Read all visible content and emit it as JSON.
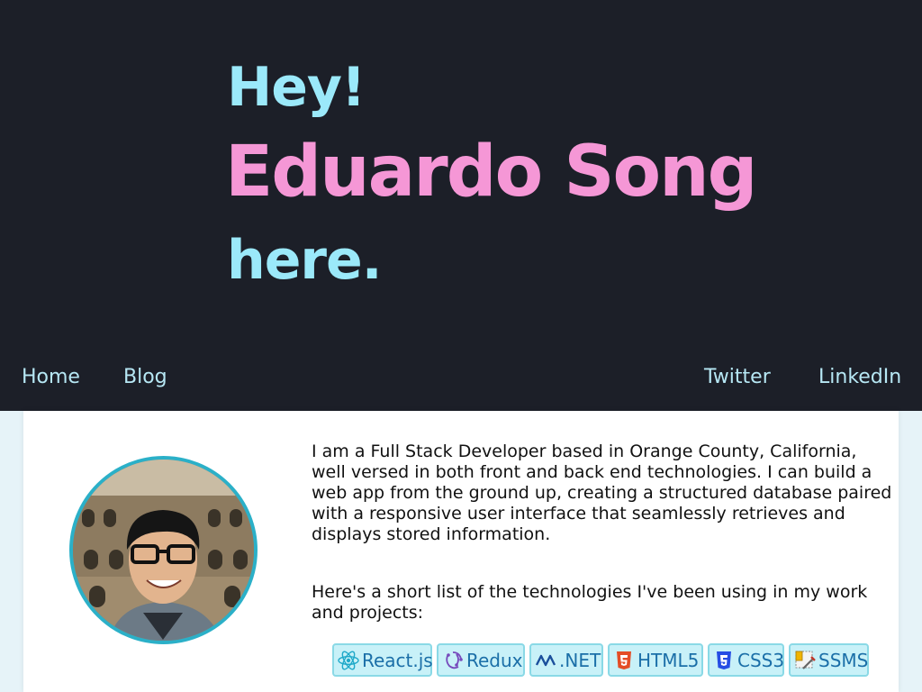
{
  "hero": {
    "greeting": "Hey!",
    "name": "Eduardo Song",
    "tail": "here."
  },
  "nav": {
    "home": "Home",
    "blog": "Blog",
    "twitter": "Twitter",
    "linkedin": "LinkedIn"
  },
  "about": {
    "bio": "I am a Full Stack Developer based in Orange County, California, well versed in both front and back end technologies. I can build a web app from the ground up, creating a structured database paired with a responsive user interface that seamlessly retrieves and displays stored information.",
    "tech_intro": "Here's a short list of the technologies I've been using in my work and projects:"
  },
  "technologies": [
    {
      "label": "React.js",
      "icon": "react-icon"
    },
    {
      "label": "Redux",
      "icon": "redux-icon"
    },
    {
      "label": ".NET",
      "icon": "dotnet-icon"
    },
    {
      "label": "HTML5",
      "icon": "html5-icon"
    },
    {
      "label": "CSS3",
      "icon": "css3-icon"
    },
    {
      "label": "SSMS",
      "icon": "ssms-icon"
    }
  ],
  "colors": {
    "hero_bg": "#1c1f28",
    "greeting": "#9be9fa",
    "name": "#f597d6",
    "nav": "#b6e7f4",
    "badge_bg": "#c8f1f8",
    "badge_text": "#1b6fa8",
    "avatar_ring": "#2bb0c8"
  }
}
